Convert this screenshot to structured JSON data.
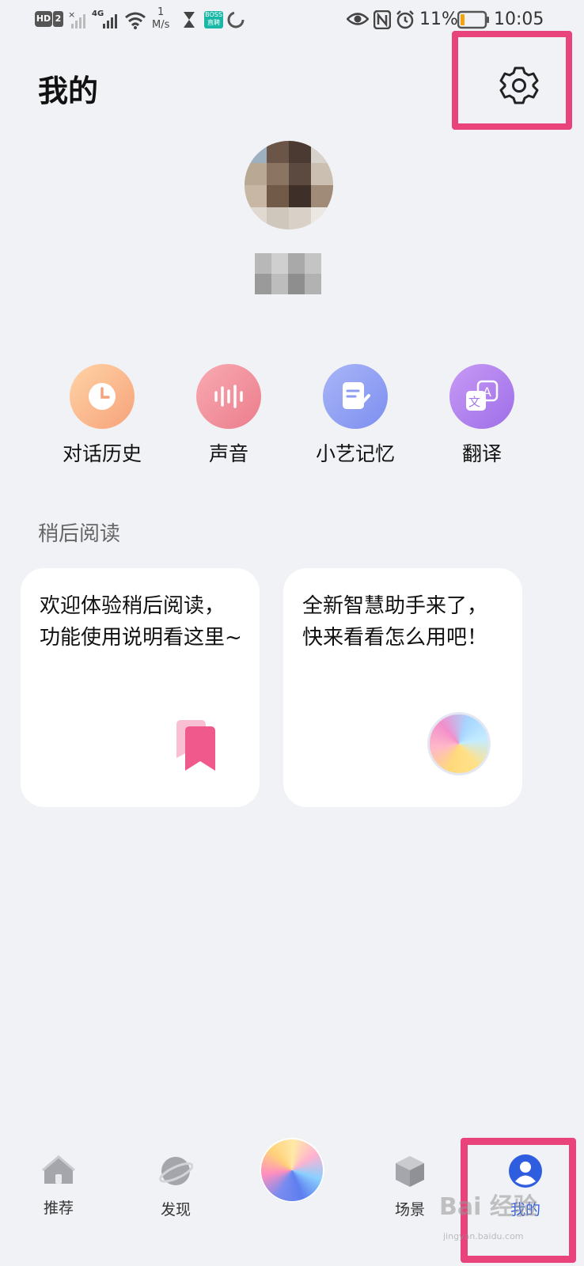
{
  "status_bar": {
    "hd": "HD",
    "sim": "2",
    "network": "4G",
    "speed_value": "1",
    "speed_unit": "M/s",
    "boss_badge": "BOSS\n直聘",
    "battery_percent": "11%",
    "time": "10:05"
  },
  "header": {
    "title": "我的"
  },
  "quick_actions": [
    {
      "label": "对话历史",
      "icon": "clock-icon",
      "color": "#fbb98a"
    },
    {
      "label": "声音",
      "icon": "waveform-icon",
      "color": "#f28e9a"
    },
    {
      "label": "小艺记忆",
      "icon": "notepad-pen-icon",
      "color": "#8e9cf2"
    },
    {
      "label": "翻译",
      "icon": "translate-icon",
      "color": "#b181ea"
    }
  ],
  "later_reading": {
    "title": "稍后阅读",
    "cards": [
      {
        "text": "欢迎体验稍后阅读，功能使用说明看这里~",
        "icon": "bookmark-icon"
      },
      {
        "text": "全新智慧助手来了，快来看看怎么用吧！",
        "icon": "celia-orb-icon"
      }
    ]
  },
  "bottom_nav": {
    "items": [
      {
        "label": "推荐",
        "icon": "home-icon",
        "active": false
      },
      {
        "label": "发现",
        "icon": "planet-icon",
        "active": false
      },
      {
        "label": "",
        "icon": "assistant-orb-icon",
        "active": false
      },
      {
        "label": "场景",
        "icon": "cube-icon",
        "active": false
      },
      {
        "label": "我的",
        "icon": "person-icon",
        "active": true
      }
    ],
    "active_color": "#2f5de0"
  },
  "watermark": {
    "main": "Bai 经验",
    "sub": "jingyan.baidu.com"
  }
}
